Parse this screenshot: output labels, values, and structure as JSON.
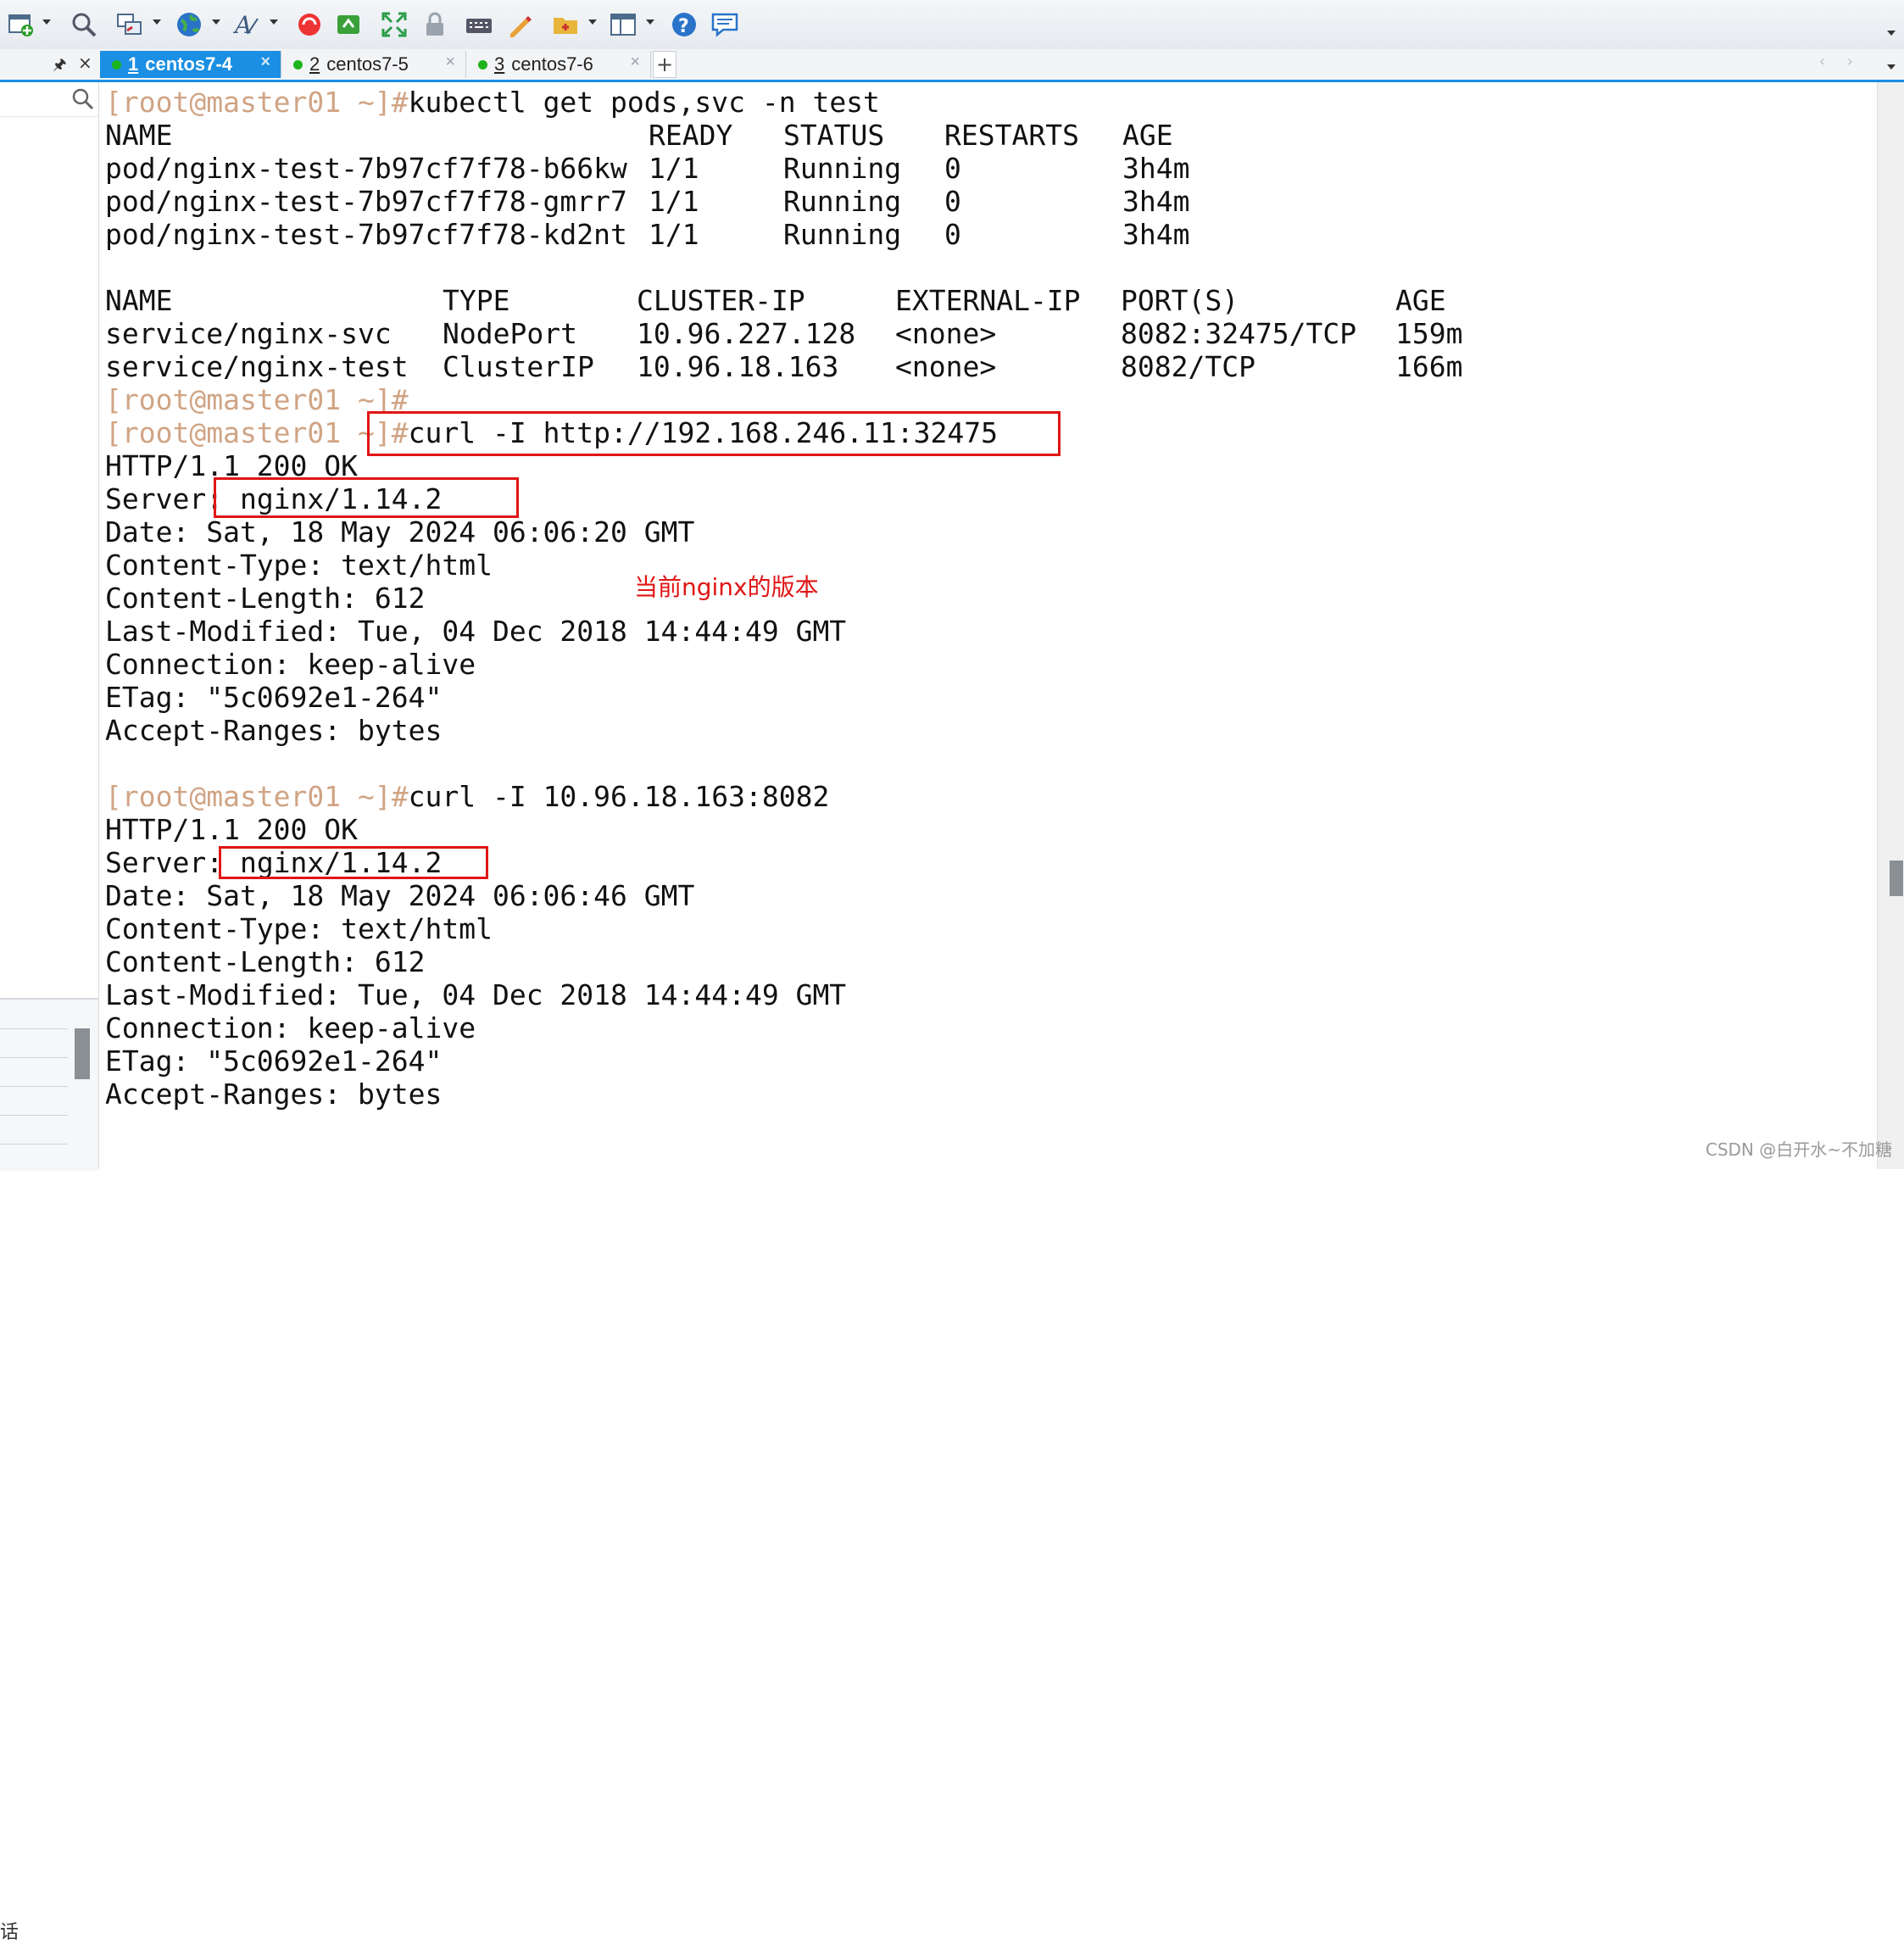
{
  "tabs": [
    {
      "number": "1",
      "label": "centos7-4",
      "active": true
    },
    {
      "number": "2",
      "label": "centos7-5",
      "active": false
    },
    {
      "number": "3",
      "label": "centos7-6",
      "active": false
    }
  ],
  "tab_add": "+",
  "prompt": "[root@master01 ~]#",
  "cmd1": "kubectl get pods,svc -n test",
  "pods_header": {
    "name": "NAME",
    "ready": "READY",
    "status": "STATUS",
    "restarts": "RESTARTS",
    "age": "AGE"
  },
  "pods": [
    {
      "name": "pod/nginx-test-7b97cf7f78-b66kw",
      "ready": "1/1",
      "status": "Running",
      "restarts": "0",
      "age": "3h4m"
    },
    {
      "name": "pod/nginx-test-7b97cf7f78-gmrr7",
      "ready": "1/1",
      "status": "Running",
      "restarts": "0",
      "age": "3h4m"
    },
    {
      "name": "pod/nginx-test-7b97cf7f78-kd2nt",
      "ready": "1/1",
      "status": "Running",
      "restarts": "0",
      "age": "3h4m"
    }
  ],
  "svc_header": {
    "name": "NAME",
    "type": "TYPE",
    "cluster_ip": "CLUSTER-IP",
    "external_ip": "EXTERNAL-IP",
    "ports": "PORT(S)",
    "age": "AGE"
  },
  "services": [
    {
      "name": "service/nginx-svc",
      "type": "NodePort",
      "cluster_ip": "10.96.227.128",
      "external_ip": "<none>",
      "ports": "8082:32475/TCP",
      "age": "159m"
    },
    {
      "name": "service/nginx-test",
      "type": "ClusterIP",
      "cluster_ip": "10.96.18.163",
      "external_ip": "<none>",
      "ports": "8082/TCP",
      "age": "166m"
    }
  ],
  "cmd2": "curl -I http://192.168.246.11:32475",
  "resp1": {
    "status": "HTTP/1.1 200 OK",
    "server_key": "Server:",
    "server_val": " nginx/1.14.2",
    "date": "Date: Sat, 18 May 2024 06:06:20 GMT",
    "content_type": "Content-Type: text/html",
    "content_length": "Content-Length: 612",
    "last_modified": "Last-Modified: Tue, 04 Dec 2018 14:44:49 GMT",
    "connection": "Connection: keep-alive",
    "etag": "ETag: \"5c0692e1-264\"",
    "accept_ranges": "Accept-Ranges: bytes"
  },
  "annotation": "当前nginx的版本",
  "cmd3": "curl -I 10.96.18.163:8082",
  "resp2": {
    "status": "HTTP/1.1 200 OK",
    "server_key": "Server:",
    "server_val": " nginx/1.14.2",
    "date": "Date: Sat, 18 May 2024 06:06:46 GMT",
    "content_type": "Content-Type: text/html",
    "content_length": "Content-Length: 612",
    "last_modified": "Last-Modified: Tue, 04 Dec 2018 14:44:49 GMT",
    "connection": "Connection: keep-alive",
    "etag": "ETag: \"5c0692e1-264\"",
    "accept_ranges": "Accept-Ranges: bytes"
  },
  "left_pane_glyph": "话",
  "watermark": "CSDN @白开水~不加糖",
  "colors": {
    "prompt": "#d0a484",
    "highlight": "#e01515",
    "tab_active": "#1a8fe3"
  },
  "icons": [
    "new-session-icon",
    "find-icon",
    "transfer-icon",
    "globe-icon",
    "font-icon",
    "xshell-icon",
    "xftp-icon",
    "fullscreen-icon",
    "lock-icon",
    "keyboard-icon",
    "script-icon",
    "session-folder-icon",
    "layout-icon",
    "help-icon",
    "chat-icon"
  ]
}
